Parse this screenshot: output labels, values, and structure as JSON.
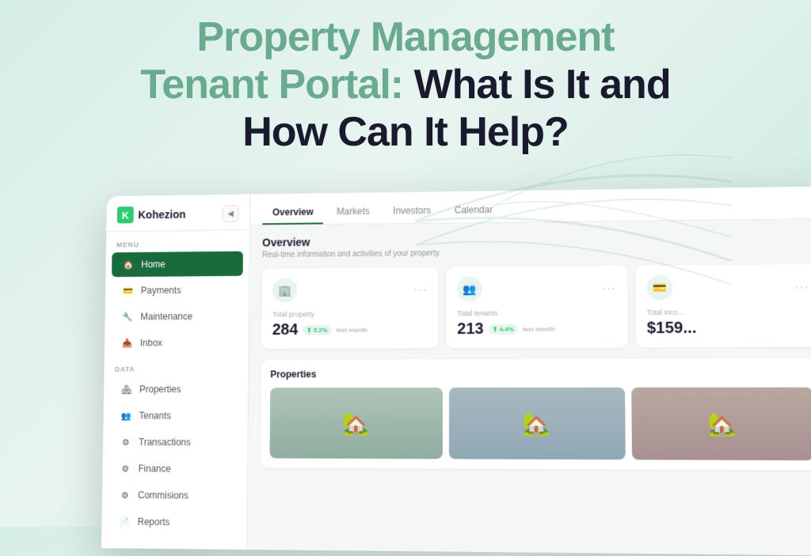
{
  "headline": {
    "line1": "Property Management",
    "line2_normal": "Tenant Portal: ",
    "line2_bold": "What Is It and",
    "line3": "How Can It Help?"
  },
  "sidebar": {
    "logo_text": "Kohezion",
    "logo_letter": "K",
    "collapse_icon": "◀",
    "menu_label": "MENU",
    "data_label": "DATA",
    "menu_items": [
      {
        "id": "home",
        "label": "Home",
        "icon": "🏠",
        "active": true
      },
      {
        "id": "payments",
        "label": "Payments",
        "icon": "💳",
        "active": false
      },
      {
        "id": "maintenance",
        "label": "Maintenance",
        "icon": "🔧",
        "active": false
      },
      {
        "id": "inbox",
        "label": "Inbox",
        "icon": "📥",
        "active": false
      }
    ],
    "data_items": [
      {
        "id": "properties",
        "label": "Properties",
        "icon": "🏘",
        "active": false
      },
      {
        "id": "tenants",
        "label": "Tenants",
        "icon": "👥",
        "active": false
      },
      {
        "id": "transactions",
        "label": "Transactions",
        "icon": "⚙",
        "active": false
      },
      {
        "id": "finance",
        "label": "Finance",
        "icon": "⚙",
        "active": false
      },
      {
        "id": "commissions",
        "label": "Commisions",
        "icon": "⚙",
        "active": false
      },
      {
        "id": "reports",
        "label": "Reports",
        "icon": "📄",
        "active": false
      }
    ]
  },
  "tabs": [
    {
      "id": "overview",
      "label": "Overview",
      "active": true
    },
    {
      "id": "markets",
      "label": "Markets",
      "active": false
    },
    {
      "id": "investors",
      "label": "Investors",
      "active": false
    },
    {
      "id": "calendar",
      "label": "Calendar",
      "active": false
    }
  ],
  "overview": {
    "title": "Overview",
    "subtitle": "Real-time information and activities of your property.",
    "stats": [
      {
        "id": "total-property",
        "icon": "🏢",
        "label": "Total property",
        "value": "284",
        "badge": "⬆ 5.2%",
        "timeframe": "last month"
      },
      {
        "id": "total-tenants",
        "icon": "👥",
        "label": "Total tenants",
        "value": "213",
        "badge": "⬆ 4.4%",
        "timeframe": "last month"
      },
      {
        "id": "total-income",
        "icon": "💳",
        "label": "Total inco...",
        "value": "$159...",
        "badge": "",
        "timeframe": ""
      }
    ],
    "properties_title": "Properties",
    "properties": [
      {
        "id": "prop1",
        "color": "#c89898"
      },
      {
        "id": "prop2",
        "color": "#9aafb8"
      },
      {
        "id": "prop3",
        "color": "#b89898"
      }
    ]
  },
  "colors": {
    "accent_green": "#1a6b3c",
    "light_green": "#2ecc71",
    "bg_green": "#e8f5ee"
  }
}
